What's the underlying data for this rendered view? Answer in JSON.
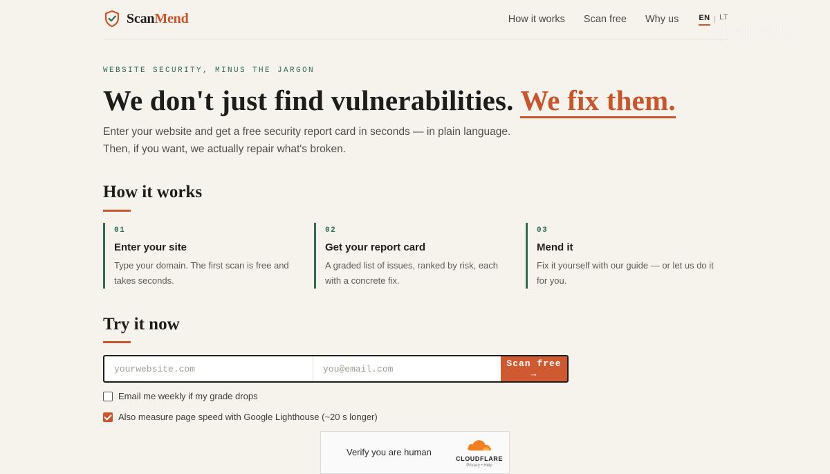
{
  "brand": {
    "name_part1": "Scan",
    "name_part2": "Mend"
  },
  "nav": {
    "items": [
      "How it works",
      "Scan free",
      "Why us"
    ],
    "lang_active": "EN",
    "lang_other": "LT",
    "lang_sep": "|"
  },
  "hero": {
    "eyebrow": "WEBSITE SECURITY, MINUS THE JARGON",
    "title_plain": "We don't just find vulnerabilities.",
    "title_accent": "We fix them.",
    "lede_line1": "Enter your website and get a free security report card in seconds — in plain language.",
    "lede_line2": "Then, if you want, we actually repair what's broken."
  },
  "how_it_works": {
    "title": "How it works",
    "steps": [
      {
        "num": "01",
        "title": "Enter your site",
        "body": "Type your domain. The first scan is free and takes seconds."
      },
      {
        "num": "02",
        "title": "Get your report card",
        "body": "A graded list of issues, ranked by risk, each with a concrete fix."
      },
      {
        "num": "03",
        "title": "Mend it",
        "body": "Fix it yourself with our guide — or let us do it for you."
      }
    ]
  },
  "try_it": {
    "title": "Try it now",
    "site_placeholder": "yourwebsite.com",
    "email_placeholder": "you@email.com",
    "button_label": "Scan free →",
    "options": [
      {
        "label": "Email me weekly if my grade drops",
        "checked": false
      },
      {
        "label": "Also measure page speed with Google Lighthouse (~20 s longer)",
        "checked": true
      }
    ]
  },
  "turnstile": {
    "label": "Verify you are human",
    "provider": "CLOUDFLARE",
    "links": "Privacy • Help"
  },
  "watermark": "skelbiu.lt",
  "colors": {
    "accent": "#c8552c",
    "green": "#2f6b4f",
    "background": "#f6f3ec"
  },
  "icons": {
    "logo": "shield-check-icon",
    "cloudflare": "cloud-icon"
  }
}
